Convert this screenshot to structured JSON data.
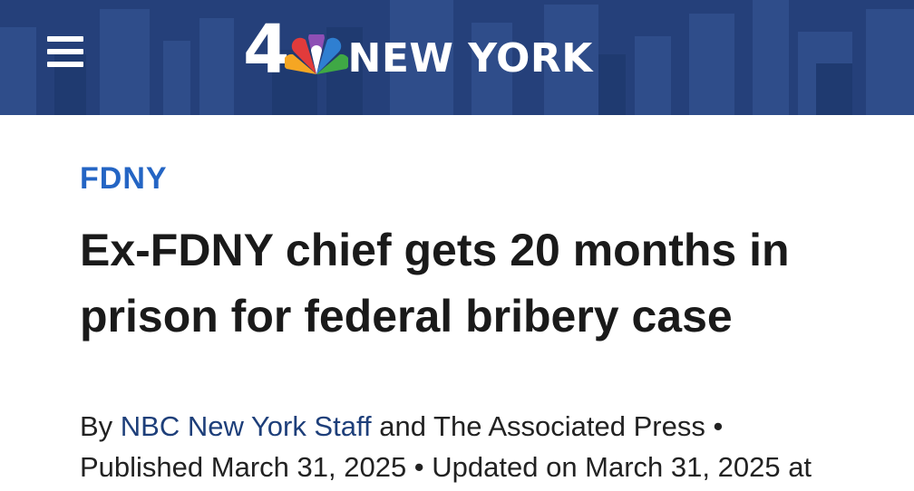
{
  "header": {
    "background_color": "#25407a",
    "logo": {
      "number": "4",
      "station": "NEW YORK",
      "icon": "nbc-peacock-icon"
    },
    "menu_icon": "hamburger-menu-icon"
  },
  "article": {
    "category": "FDNY",
    "category_color": "#2465c4",
    "headline": "Ex-FDNY chief gets 20 months in prison for federal bribery case",
    "byline": {
      "prefix": "By ",
      "author_link": "NBC New York Staff",
      "author_link_color": "#1e3f7a",
      "suffix": " and The Associated Press •",
      "published": "Published March 31, 2025 • Updated on March 31, 2025 at"
    }
  }
}
